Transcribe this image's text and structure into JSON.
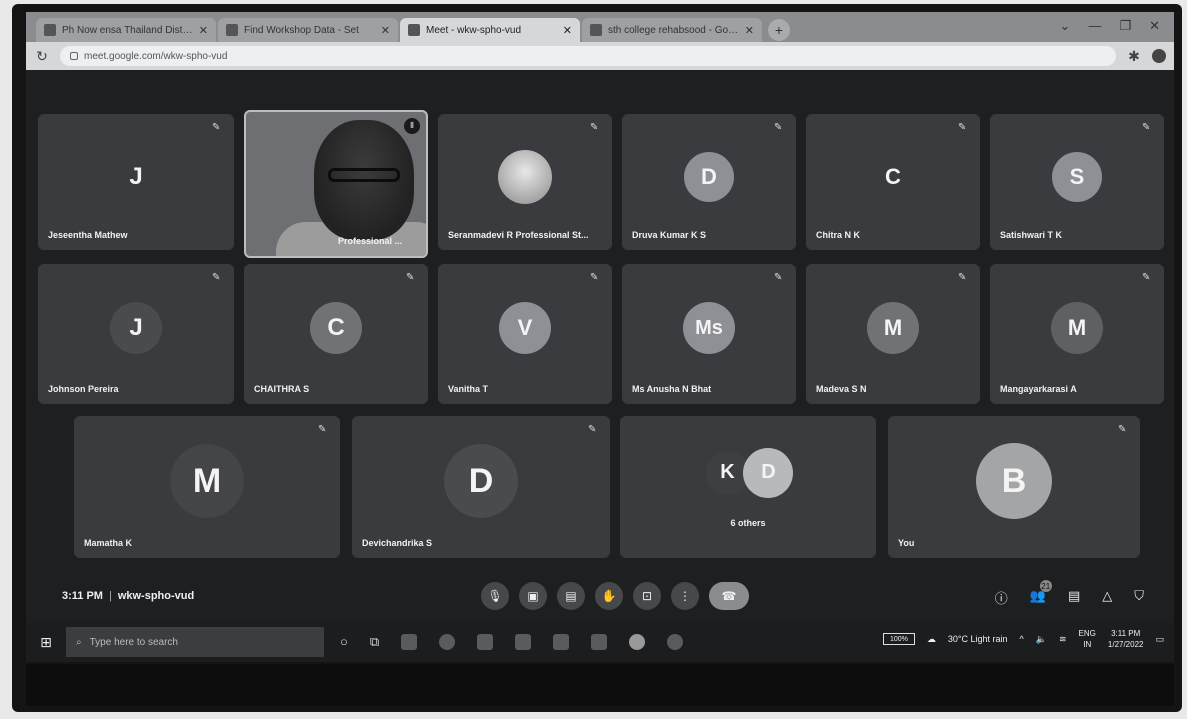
{
  "browser": {
    "tabs": [
      {
        "title": "Ph Now ensa Thailand Distinc"
      },
      {
        "title": "Find Workshop Data - Set"
      },
      {
        "title": "Meet - wkw-spho-vud",
        "active": true
      },
      {
        "title": "sth college rehabsood - Google S"
      }
    ],
    "new_tab": "+",
    "url": "meet.google.com/wkw-spho-vud"
  },
  "meet": {
    "participants_row1": [
      {
        "name": "Jeseentha Mathew",
        "initial": "J"
      },
      {
        "name": "Professional ...",
        "video": true
      },
      {
        "name": "Seranmadevi R Professional St..."
      },
      {
        "name": "Druva Kumar K S",
        "initial": "D"
      },
      {
        "name": "Chitra N K",
        "initial": "C"
      },
      {
        "name": "Satishwari T K",
        "initial": "S"
      }
    ],
    "participants_row2": [
      {
        "name": "Johnson Pereira",
        "initial": "J"
      },
      {
        "name": "CHAITHRA S",
        "initial": "C"
      },
      {
        "name": "Vanitha T",
        "initial": "V"
      },
      {
        "name": "Ms Anusha N Bhat",
        "initial": "Ms"
      },
      {
        "name": "Madeva S N",
        "initial": "M"
      },
      {
        "name": "Mangayarkarasi A",
        "initial": "M"
      }
    ],
    "participants_row3": [
      {
        "name": "Mamatha K",
        "initial": "M"
      },
      {
        "name": "Devichandrika S",
        "initial": "D"
      },
      {
        "name": "6 others",
        "initial_a": "K",
        "initial_b": "D"
      },
      {
        "name": "You",
        "initial": "B"
      }
    ],
    "time": "3:11 PM",
    "code": "wkw-spho-vud",
    "people_count": "21"
  },
  "taskbar": {
    "search_placeholder": "Type here to search",
    "battery": "100%",
    "weather": "30°C Light rain",
    "lang": "ENG",
    "region": "IN",
    "clock_time": "3:11 PM",
    "clock_date": "1/27/2022"
  },
  "colors": {
    "tile": "#3a3b3e",
    "background": "#1e1f21",
    "avatar": "#8e9095"
  }
}
